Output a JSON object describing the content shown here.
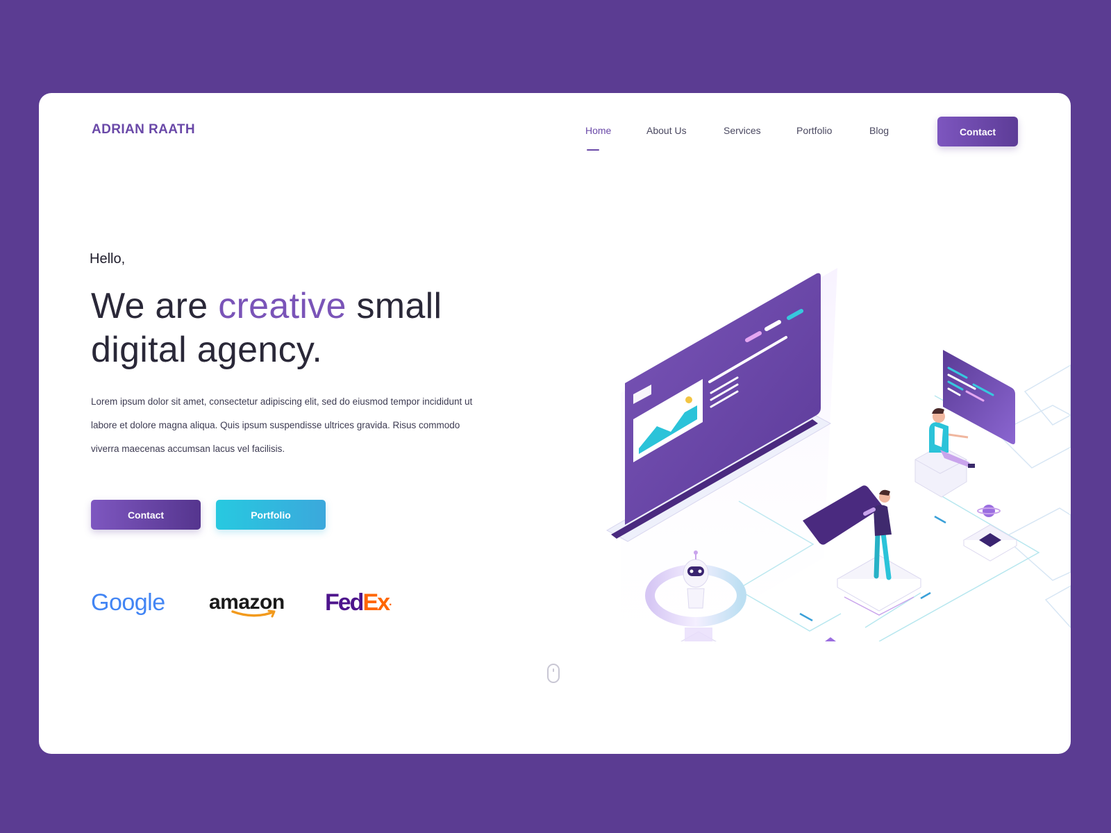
{
  "brand": {
    "name": "ADRIAN RAATH"
  },
  "nav": {
    "items": [
      {
        "label": "Home",
        "active": true
      },
      {
        "label": "About Us",
        "active": false
      },
      {
        "label": "Services",
        "active": false
      },
      {
        "label": "Portfolio",
        "active": false
      },
      {
        "label": "Blog",
        "active": false
      }
    ],
    "cta_label": "Contact"
  },
  "hero": {
    "greeting": "Hello,",
    "headline_pre": "We are ",
    "headline_accent": "creative",
    "headline_post": " small digital agency.",
    "paragraph": "Lorem ipsum dolor sit amet, consectetur adipiscing elit, sed do eiusmod tempor incididunt ut labore et dolore magna aliqua. Quis ipsum suspendisse ultrices gravida. Risus commodo viverra maecenas accumsan lacus vel facilisis.",
    "primary_button": "Contact",
    "secondary_button": "Portfolio"
  },
  "clients": {
    "google": "Google",
    "amazon": "amazon",
    "fedex_fed": "Fed",
    "fedex_ex": "Ex",
    "fedex_mark": "."
  },
  "colors": {
    "background": "#5b3c92",
    "accent_purple": "#7a54b8",
    "accent_cyan": "#27c9e0",
    "text_dark": "#2a2838"
  },
  "icons": {
    "scroll": "mouse-scroll-icon"
  }
}
